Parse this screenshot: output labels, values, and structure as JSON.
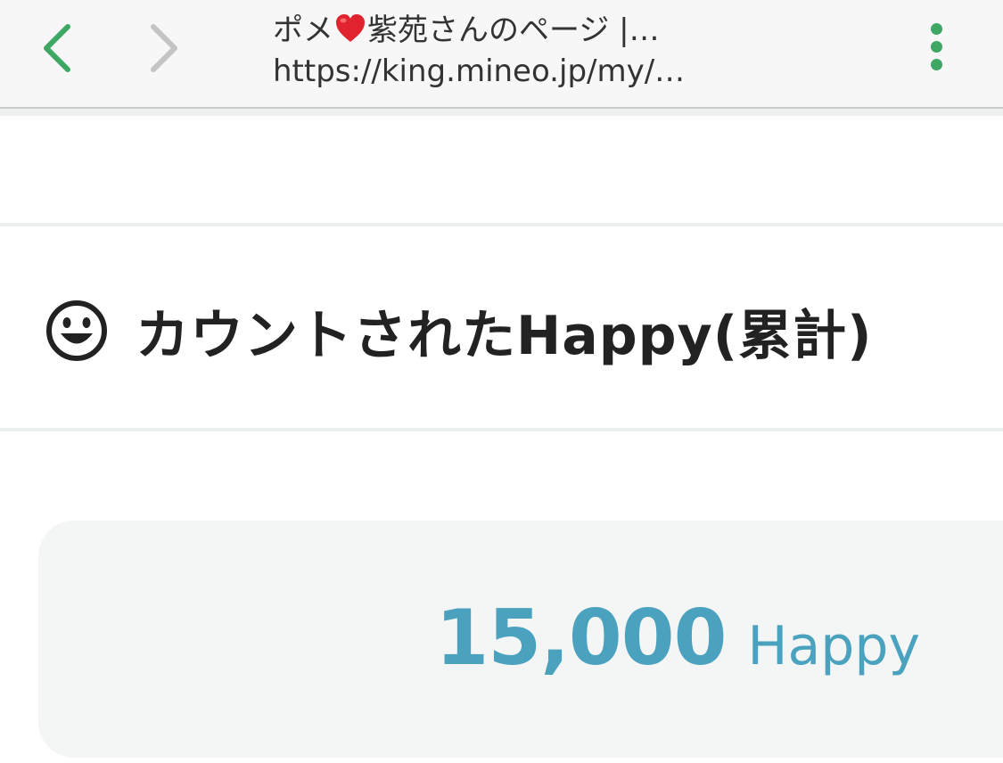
{
  "browser": {
    "tab_title_before": "ポメ",
    "tab_title_after": "紫苑さんのページ |…",
    "url": "https://king.mineo.jp/my/…",
    "icons": {
      "back": "chevron-left-icon",
      "forward": "chevron-right-icon",
      "menu": "more-vertical-icon",
      "heart": "heart-emoji-icon"
    },
    "colors": {
      "nav_active": "#3fa764",
      "nav_disabled": "#c4c4c4",
      "heart": "#e0232f"
    }
  },
  "section": {
    "heading": "カウントされたHappy(累計)",
    "icon": "smiley-icon"
  },
  "happy_count": {
    "value": "15,000",
    "unit": "Happy",
    "color": "#4aa2be"
  }
}
